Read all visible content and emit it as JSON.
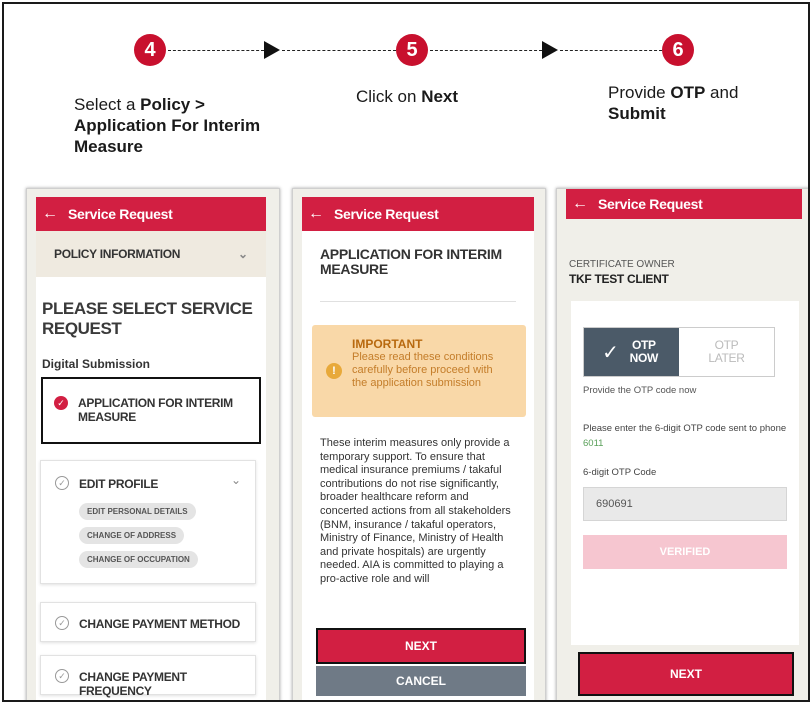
{
  "steps": [
    {
      "number": "4",
      "caption_parts": [
        "Select a ",
        "Policy >",
        " ",
        "Application For Interim Measure"
      ]
    },
    {
      "number": "5",
      "caption_parts": [
        "Click on ",
        "Next"
      ]
    },
    {
      "number": "6",
      "caption_parts": [
        "Provide ",
        "OTP",
        " and ",
        "Submit"
      ]
    }
  ],
  "screen1": {
    "header_title": "Service Request",
    "policy_info": "POLICY INFORMATION",
    "select_title": "PLEASE SELECT SERVICE REQUEST",
    "section": "Digital Submission",
    "items": {
      "interim": "APPLICATION FOR INTERIM MEASURE",
      "edit_profile": "EDIT PROFILE",
      "chips": [
        "EDIT PERSONAL DETAILS",
        "CHANGE OF ADDRESS",
        "CHANGE OF OCCUPATION"
      ],
      "payment_method": "CHANGE PAYMENT METHOD",
      "payment_frequency": "CHANGE PAYMENT FREQUENCY"
    }
  },
  "screen2": {
    "header_title": "Service Request",
    "title": "APPLICATION FOR INTERIM MEASURE",
    "important_title": "IMPORTANT",
    "important_text": "Please read these conditions carefully before proceed with the application submission",
    "body": "These interim measures only provide a temporary support. To ensure that medical insurance premiums / takaful contributions do not rise significantly, broader healthcare reform and concerted actions from all stakeholders (BNM, insurance / takaful operators, Ministry of Finance, Ministry of Health and private hospitals) are urgently needed. AIA is committed to playing a pro-active role and will",
    "next": "NEXT",
    "cancel": "CANCEL"
  },
  "screen3": {
    "header_title": "Service Request",
    "owner_label": "CERTIFICATE OWNER",
    "owner_name": "TKF TEST CLIENT",
    "otp_now": "OTP NOW",
    "otp_later": "OTP LATER",
    "provide_text": "Provide the OTP code now",
    "enter_text_1": "Please enter the 6-digit OTP code sent to phone ",
    "phone_suffix": "6011",
    "code_label": "6-digit OTP Code",
    "code_value": "690691",
    "verified": "VERIFIED",
    "next": "NEXT"
  },
  "colors": {
    "brand_red": "#d21f42",
    "step_red": "#c8102e",
    "cancel_gray": "#6f7a86",
    "phone_green": "#5aa05a"
  }
}
